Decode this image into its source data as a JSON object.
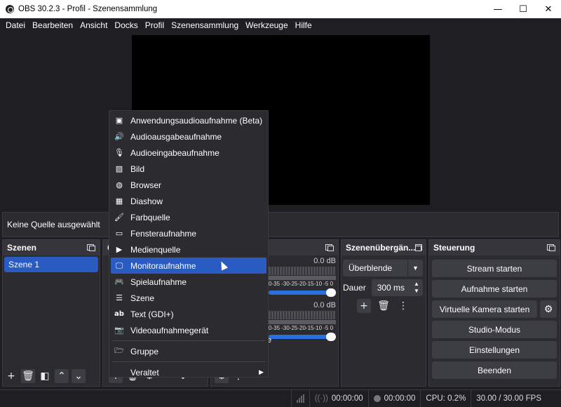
{
  "window": {
    "title": "OBS 30.2.3 - Profil  - Szenensammlung"
  },
  "menubar": [
    "Datei",
    "Bearbeiten",
    "Ansicht",
    "Docks",
    "Profil",
    "Szenensammlung",
    "Werkzeuge",
    "Hilfe"
  ],
  "source_status": "Keine Quelle ausgewählt",
  "scenes": {
    "title": "Szenen",
    "items": [
      "Szene 1"
    ]
  },
  "sources": {
    "title_fragment": "Q"
  },
  "audio": {
    "channels": [
      {
        "db": "0.0 dB",
        "ticks": "0-35 -30-25-20-15-10 -5  0"
      },
      {
        "db": "0.0 dB",
        "ticks": "0-35 -30-25-20-15-10 -5  0"
      }
    ],
    "partial_label": "e"
  },
  "transitions": {
    "title": "Szenenübergän...",
    "selected": "Überblende",
    "duration_label": "Dauer",
    "duration_value": "300 ms"
  },
  "controls": {
    "title": "Steuerung",
    "stream": "Stream starten",
    "record": "Aufnahme starten",
    "virtual_cam": "Virtuelle Kamera starten",
    "studio": "Studio-Modus",
    "settings": "Einstellungen",
    "exit": "Beenden"
  },
  "statusbar": {
    "stream_time": "00:00:00",
    "rec_time": "00:00:00",
    "cpu": "CPU: 0.2%",
    "fps": "30.00 / 30.00 FPS"
  },
  "context_menu": {
    "items": [
      {
        "label": "Anwendungsaudioaufnahme (Beta)",
        "icon": "app-audio-icon"
      },
      {
        "label": "Audioausgabeaufnahme",
        "icon": "speaker-icon"
      },
      {
        "label": "Audioeingabeaufnahme",
        "icon": "microphone-icon"
      },
      {
        "label": "Bild",
        "icon": "image-icon"
      },
      {
        "label": "Browser",
        "icon": "globe-icon"
      },
      {
        "label": "Diashow",
        "icon": "slideshow-icon"
      },
      {
        "label": "Farbquelle",
        "icon": "brush-icon"
      },
      {
        "label": "Fensteraufnahme",
        "icon": "window-icon"
      },
      {
        "label": "Medienquelle",
        "icon": "play-icon"
      },
      {
        "label": "Monitoraufnahme",
        "icon": "monitor-icon",
        "highlighted": true
      },
      {
        "label": "Spielaufnahme",
        "icon": "gamepad-icon"
      },
      {
        "label": "Szene",
        "icon": "list-icon"
      },
      {
        "label": "Text (GDI+)",
        "icon": "text-icon"
      },
      {
        "label": "Videoaufnahmegerät",
        "icon": "camera-icon"
      }
    ],
    "group": "Gruppe",
    "deprecated": "Veraltet"
  }
}
